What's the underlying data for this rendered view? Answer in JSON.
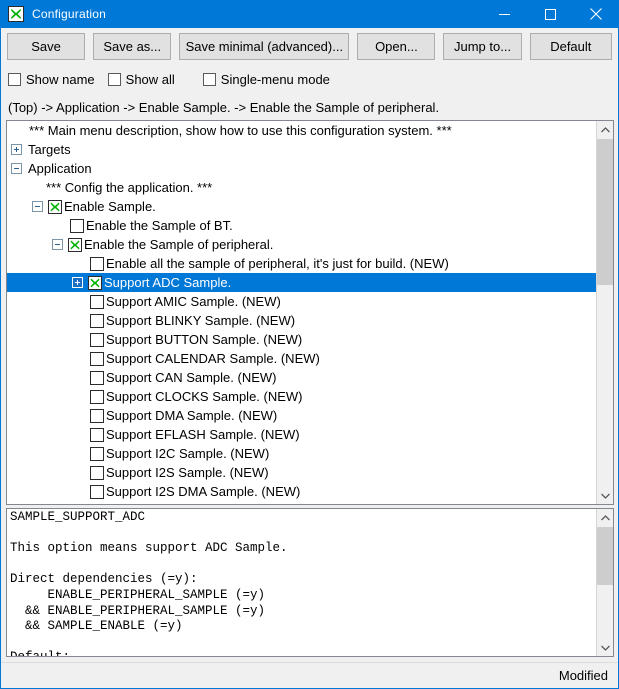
{
  "window": {
    "title": "Configuration",
    "icon": "green-x-icon",
    "accent_color": "#0078d7",
    "controls": {
      "minimize": "minimize-icon",
      "maximize": "maximize-icon",
      "close": "close-icon"
    }
  },
  "toolbar": {
    "buttons": [
      {
        "label": "Save",
        "name": "save-button"
      },
      {
        "label": "Save as...",
        "name": "save-as-button"
      },
      {
        "label": "Save minimal (advanced)...",
        "name": "save-minimal-button"
      },
      {
        "label": "Open...",
        "name": "open-button"
      },
      {
        "label": "Jump to...",
        "name": "jump-to-button"
      },
      {
        "label": "Default",
        "name": "default-button"
      }
    ]
  },
  "options": {
    "show_name": {
      "label": "Show name",
      "checked": false
    },
    "show_all": {
      "label": "Show all",
      "checked": false
    },
    "single_menu_mode": {
      "label": "Single-menu mode",
      "checked": false
    }
  },
  "breadcrumb": {
    "text": "(Top) -> Application -> Enable Sample. -> Enable the Sample of peripheral."
  },
  "tree": {
    "rows": [
      {
        "indent": 22,
        "kind": "text",
        "label": "*** Main menu description, show how to use this configuration system. ***"
      },
      {
        "indent": 4,
        "kind": "expander",
        "expander": "plus",
        "label": "Targets"
      },
      {
        "indent": 4,
        "kind": "expander",
        "expander": "minus",
        "label": "Application"
      },
      {
        "indent": 39,
        "kind": "text",
        "label": "*** Config the application. ***"
      },
      {
        "indent": 25,
        "kind": "expander-check",
        "expander": "minus",
        "checked": true,
        "label": "Enable Sample."
      },
      {
        "indent": 63,
        "kind": "check",
        "checked": false,
        "label": "Enable the Sample of BT."
      },
      {
        "indent": 45,
        "kind": "expander-check",
        "expander": "minus",
        "checked": true,
        "label": "Enable the Sample of peripheral."
      },
      {
        "indent": 83,
        "kind": "check",
        "checked": false,
        "label": "Enable all the sample of peripheral, it's just for build. (NEW)"
      },
      {
        "indent": 65,
        "kind": "expander-check",
        "expander": "plus",
        "checked": true,
        "label": "Support ADC Sample.",
        "selected": true
      },
      {
        "indent": 83,
        "kind": "check",
        "checked": false,
        "label": "Support AMIC Sample. (NEW)"
      },
      {
        "indent": 83,
        "kind": "check",
        "checked": false,
        "label": "Support BLINKY Sample. (NEW)"
      },
      {
        "indent": 83,
        "kind": "check",
        "checked": false,
        "label": "Support BUTTON Sample. (NEW)"
      },
      {
        "indent": 83,
        "kind": "check",
        "checked": false,
        "label": "Support CALENDAR Sample. (NEW)"
      },
      {
        "indent": 83,
        "kind": "check",
        "checked": false,
        "label": "Support CAN Sample. (NEW)"
      },
      {
        "indent": 83,
        "kind": "check",
        "checked": false,
        "label": "Support CLOCKS Sample. (NEW)"
      },
      {
        "indent": 83,
        "kind": "check",
        "checked": false,
        "label": "Support DMA Sample. (NEW)"
      },
      {
        "indent": 83,
        "kind": "check",
        "checked": false,
        "label": "Support EFLASH Sample. (NEW)"
      },
      {
        "indent": 83,
        "kind": "check",
        "checked": false,
        "label": "Support I2C Sample. (NEW)"
      },
      {
        "indent": 83,
        "kind": "check",
        "checked": false,
        "label": "Support I2S Sample. (NEW)"
      },
      {
        "indent": 83,
        "kind": "check",
        "checked": false,
        "label": "Support I2S DMA Sample. (NEW)"
      }
    ]
  },
  "help": {
    "text": "SAMPLE_SUPPORT_ADC\n\nThis option means support ADC Sample.\n\nDirect dependencies (=y):\n     ENABLE_PERIPHERAL_SAMPLE (=y)\n  && ENABLE_PERIPHERAL_SAMPLE (=y)\n  && SAMPLE_ENABLE (=y)\n\nDefault:\n  - n"
  },
  "statusbar": {
    "text": "Modified"
  }
}
